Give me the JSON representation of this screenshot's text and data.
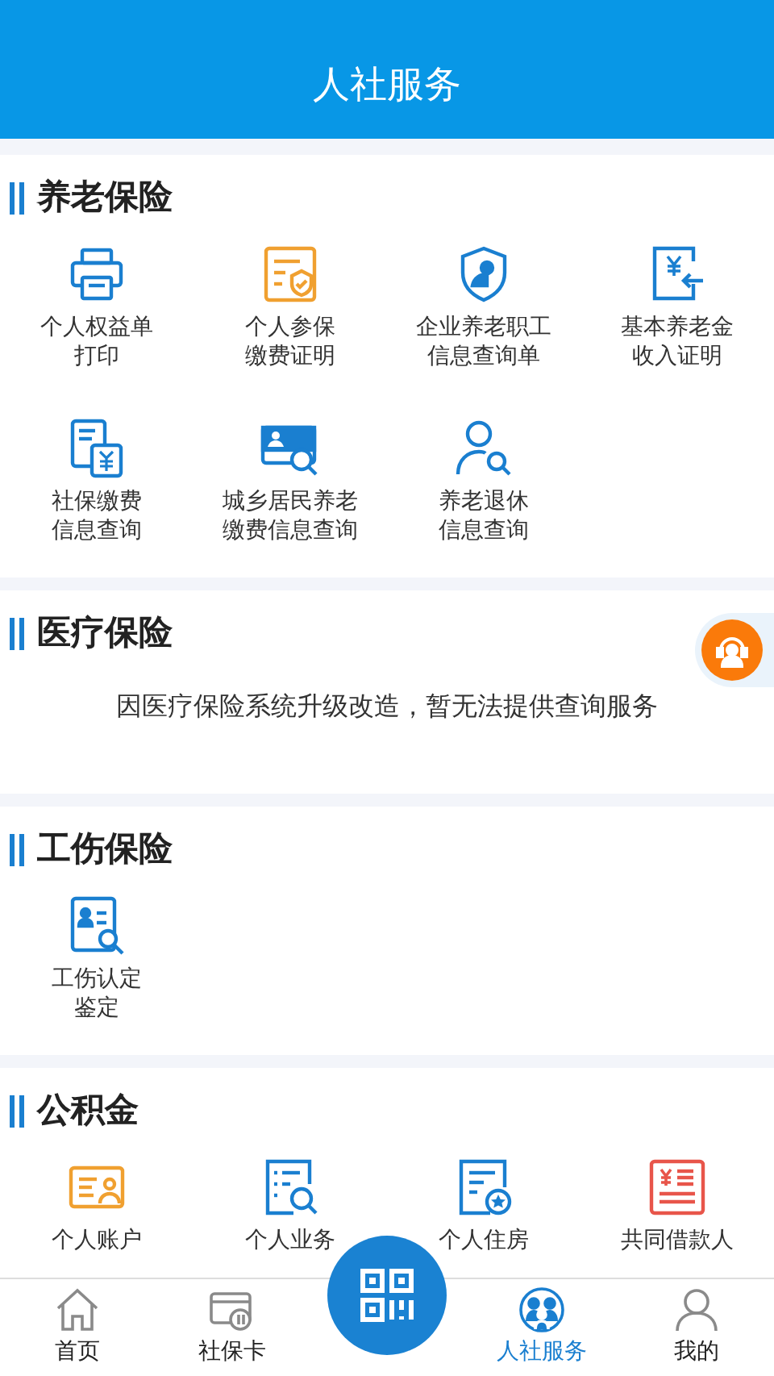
{
  "header": {
    "title": "人社服务"
  },
  "sections": [
    {
      "title": "养老保险",
      "kind": "grid",
      "items": [
        {
          "lines": [
            "个人权益单",
            "打印"
          ]
        },
        {
          "lines": [
            "个人参保",
            "缴费证明"
          ]
        },
        {
          "lines": [
            "企业养老职工",
            "信息查询单"
          ]
        },
        {
          "lines": [
            "基本养老金",
            "收入证明"
          ]
        },
        {
          "lines": [
            "社保缴费",
            "信息查询"
          ]
        },
        {
          "lines": [
            "城乡居民养老",
            "缴费信息查询"
          ]
        },
        {
          "lines": [
            "养老退休",
            "信息查询"
          ]
        }
      ]
    },
    {
      "title": "医疗保险",
      "kind": "notice",
      "text": "因医疗保险系统升级改造，暂无法提供查询服务"
    },
    {
      "title": "工伤保险",
      "kind": "grid",
      "items": [
        {
          "lines": [
            "工伤认定",
            "鉴定"
          ]
        }
      ]
    },
    {
      "title": "公积金",
      "kind": "grid",
      "items": [
        {
          "lines": [
            "个人账户"
          ]
        },
        {
          "lines": [
            "个人业务"
          ]
        },
        {
          "lines": [
            "个人住房"
          ]
        },
        {
          "lines": [
            "共同借款人"
          ]
        }
      ]
    }
  ],
  "tab_bar": {
    "items": [
      {
        "label": "首页",
        "selected": false
      },
      {
        "label": "社保卡",
        "selected": false
      },
      {
        "label": "人社服务",
        "selected": true
      },
      {
        "label": "我的",
        "selected": false
      }
    ]
  }
}
